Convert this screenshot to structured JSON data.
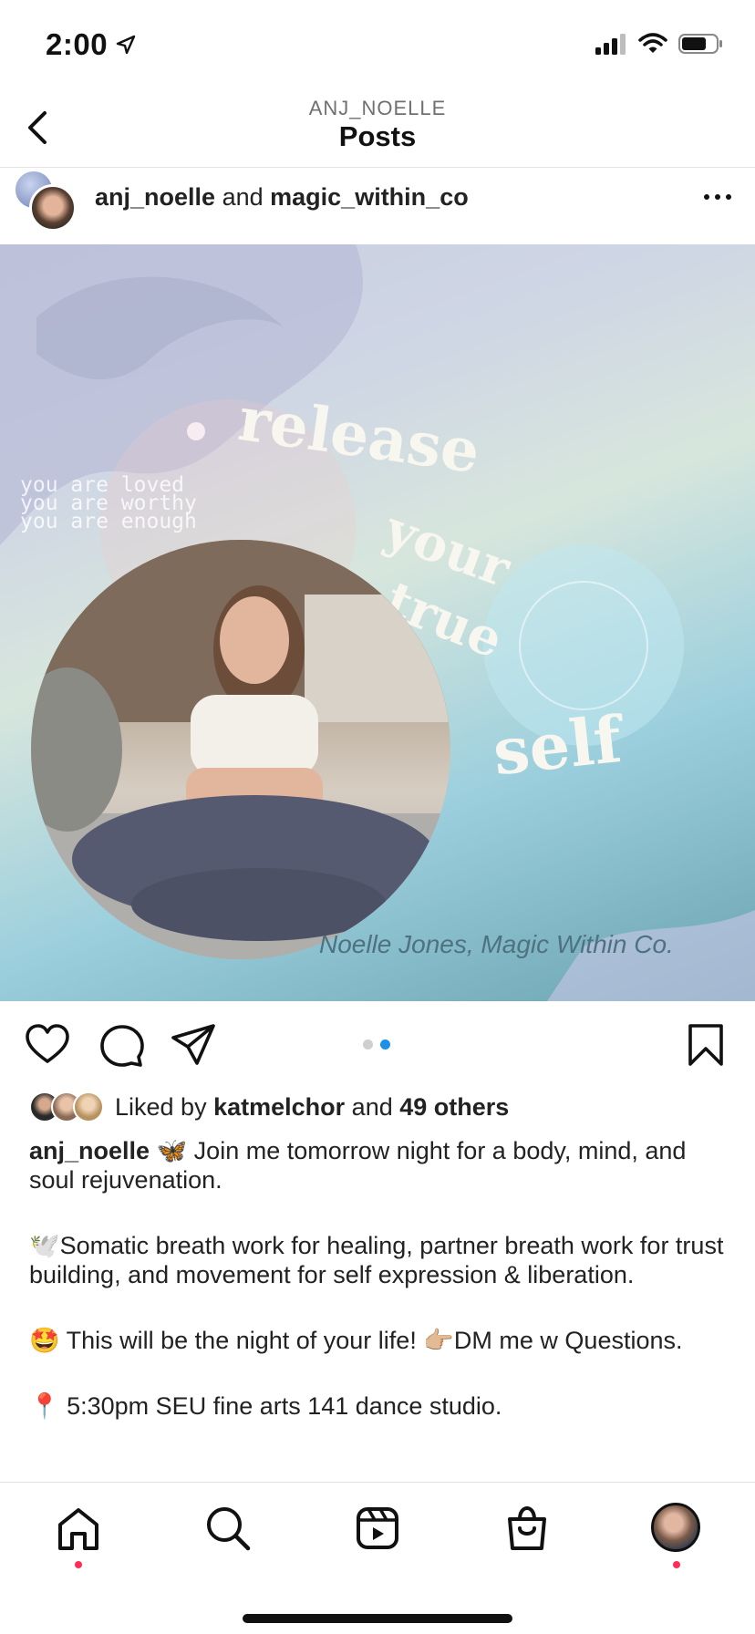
{
  "status_bar": {
    "time": "2:00",
    "icons": [
      "location-arrow-icon",
      "signal-icon",
      "wifi-icon",
      "battery-icon"
    ]
  },
  "header": {
    "username": "ANJ_NOELLE",
    "title": "Posts",
    "back_icon": "chevron-left-icon"
  },
  "post": {
    "author": "anj_noelle",
    "joiner": "and",
    "collaborator": "magic_within_co",
    "more_icon": "ellipsis-icon",
    "media": {
      "affirmations": [
        "you are loved",
        "you are worthy",
        "you are enough"
      ],
      "headline": "release your true self",
      "credit": "Noelle Jones, Magic Within Co.",
      "carousel": {
        "count": 2,
        "active_index": 1
      }
    },
    "actions": [
      "heart-icon",
      "comment-icon",
      "share-icon",
      "bookmark-icon"
    ],
    "likes": {
      "prefix": "Liked by",
      "user": "katmelchor",
      "joiner": "and",
      "others": "49 others"
    },
    "caption": {
      "author": "anj_noelle",
      "line1": "🦋 Join me tomorrow night for a body, mind, and soul rejuvenation.",
      "line2": "🕊️Somatic breath work for healing, partner breath work for trust building, and movement for self expression & liberation.",
      "line3": "🤩 This will be the night of your life! 👉🏼DM me w Questions.",
      "line4": "📍 5:30pm SEU fine arts 141 dance studio."
    }
  },
  "bottom_nav": {
    "items": [
      "home-icon",
      "search-icon",
      "reels-icon",
      "shop-icon",
      "profile-avatar"
    ],
    "accent": "#ff2d55"
  },
  "colors": {
    "carousel_active": "#1d8fe6",
    "carousel_inactive": "#cfcfcf"
  }
}
